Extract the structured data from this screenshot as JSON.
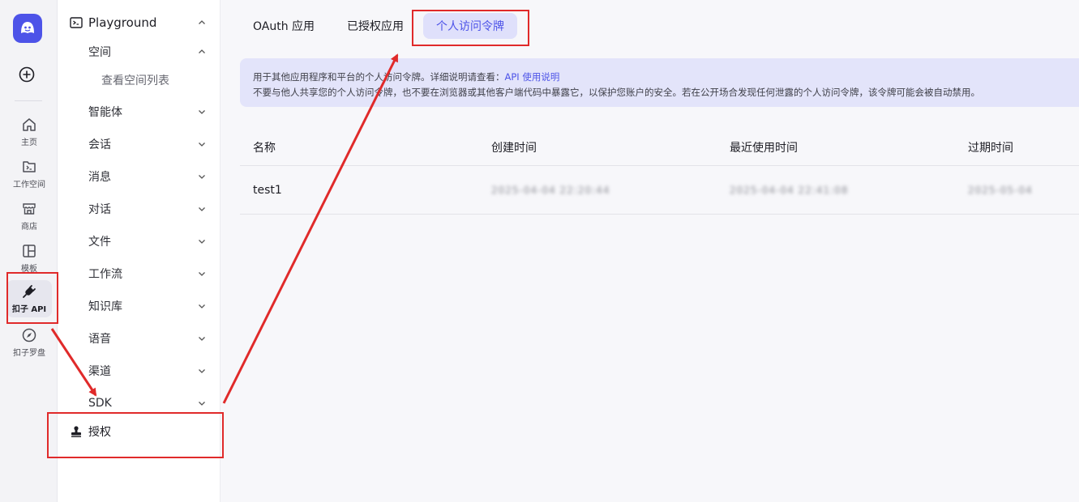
{
  "rail": {
    "items": [
      {
        "label": "主页",
        "icon": "home-icon"
      },
      {
        "label": "工作空间",
        "icon": "workspace-icon"
      },
      {
        "label": "商店",
        "icon": "store-icon"
      },
      {
        "label": "模板",
        "icon": "template-icon"
      },
      {
        "label": "扣子 API",
        "icon": "plug-icon"
      },
      {
        "label": "扣子罗盘",
        "icon": "compass-icon"
      }
    ]
  },
  "sidebar": {
    "top_label": "Playground",
    "items": [
      {
        "label": "空间"
      },
      {
        "label": "智能体"
      },
      {
        "label": "会话"
      },
      {
        "label": "消息"
      },
      {
        "label": "对话"
      },
      {
        "label": "文件"
      },
      {
        "label": "工作流"
      },
      {
        "label": "知识库"
      },
      {
        "label": "语音"
      },
      {
        "label": "渠道"
      },
      {
        "label": "SDK"
      }
    ],
    "sub_item": "查看空间列表",
    "auth_label": "授权"
  },
  "tabs": [
    "OAuth 应用",
    "已授权应用",
    "个人访问令牌"
  ],
  "notice": {
    "line1_prefix": "用于其他应用程序和平台的个人访问令牌。详细说明请查看：",
    "line1_link": "API 使用说明",
    "line2": "不要与他人共享您的个人访问令牌，也不要在浏览器或其他客户端代码中暴露它，以保护您账户的安全。若在公开场合发现任何泄露的个人访问令牌，该令牌可能会被自动禁用。"
  },
  "table": {
    "headers": [
      "名称",
      "创建时间",
      "最近使用时间",
      "过期时间"
    ],
    "rows": [
      {
        "name": "test1",
        "created": "2025-04-04 22:20:44",
        "last_used": "2025-04-04 22:41:08",
        "expires": "2025-05-04"
      }
    ]
  },
  "colors": {
    "accent": "#4d53e8",
    "highlight": "#e02a2a"
  }
}
